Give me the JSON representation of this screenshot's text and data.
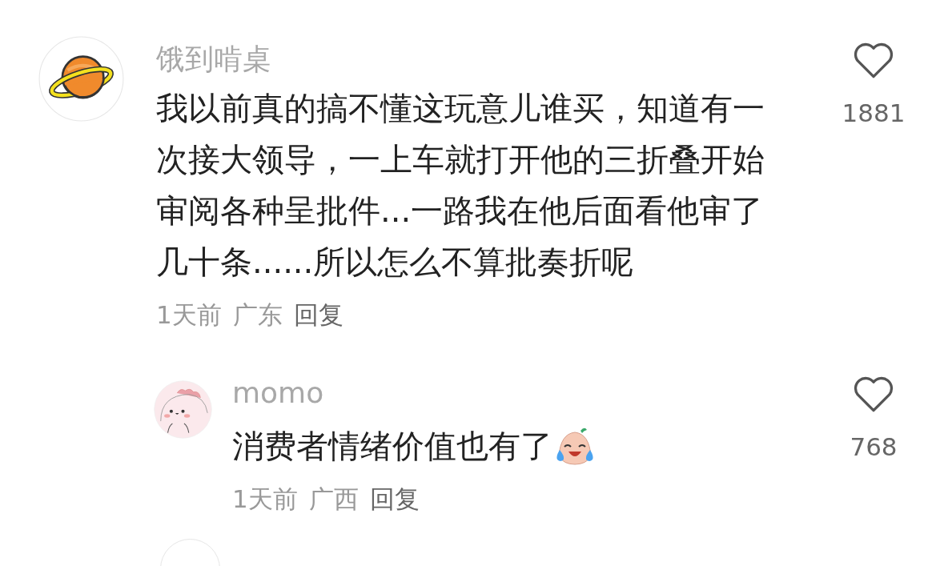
{
  "comments": [
    {
      "author": "饿到啃桌",
      "text": "我以前真的搞不懂这玩意儿谁买，知道有一次接大领导，一上车就打开他的三折叠开始审阅各种呈批件...一路我在他后面看他审了几十条......所以怎么不算批奏折呢",
      "time": "1天前",
      "location": "广东",
      "reply_label": "回复",
      "likes": "1881",
      "replies": [
        {
          "author": "momo",
          "text": "消费者情绪价值也有了",
          "has_emoji": true,
          "time": "1天前",
          "location": "广西",
          "reply_label": "回复",
          "likes": "768"
        }
      ]
    }
  ]
}
